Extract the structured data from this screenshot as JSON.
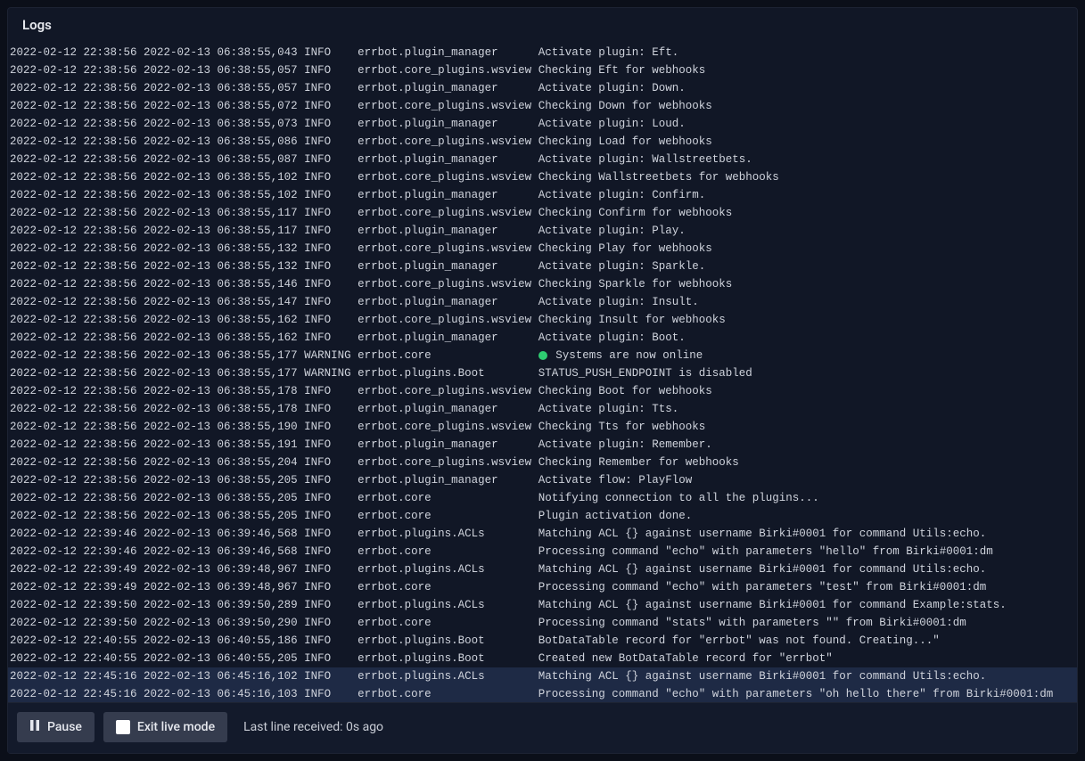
{
  "header": {
    "title": "Logs"
  },
  "columns": {
    "ts1_width": 9,
    "ts2_width": 24,
    "level_width": 8,
    "logger_width": 26
  },
  "footer": {
    "pause_label": "Pause",
    "exit_label": "Exit live mode",
    "last_line_label": "Last line received: 0s ago"
  },
  "logs": [
    {
      "ts1": "2022-02-12 22:38:56",
      "ts2": "2022-02-13 06:38:55,043",
      "level": "INFO",
      "logger": "errbot.plugin_manager",
      "msg": "Activate plugin: Eft."
    },
    {
      "ts1": "2022-02-12 22:38:56",
      "ts2": "2022-02-13 06:38:55,057",
      "level": "INFO",
      "logger": "errbot.core_plugins.wsview",
      "msg": "Checking Eft for webhooks"
    },
    {
      "ts1": "2022-02-12 22:38:56",
      "ts2": "2022-02-13 06:38:55,057",
      "level": "INFO",
      "logger": "errbot.plugin_manager",
      "msg": "Activate plugin: Down."
    },
    {
      "ts1": "2022-02-12 22:38:56",
      "ts2": "2022-02-13 06:38:55,072",
      "level": "INFO",
      "logger": "errbot.core_plugins.wsview",
      "msg": "Checking Down for webhooks"
    },
    {
      "ts1": "2022-02-12 22:38:56",
      "ts2": "2022-02-13 06:38:55,073",
      "level": "INFO",
      "logger": "errbot.plugin_manager",
      "msg": "Activate plugin: Loud."
    },
    {
      "ts1": "2022-02-12 22:38:56",
      "ts2": "2022-02-13 06:38:55,086",
      "level": "INFO",
      "logger": "errbot.core_plugins.wsview",
      "msg": "Checking Load for webhooks"
    },
    {
      "ts1": "2022-02-12 22:38:56",
      "ts2": "2022-02-13 06:38:55,087",
      "level": "INFO",
      "logger": "errbot.plugin_manager",
      "msg": "Activate plugin: Wallstreetbets."
    },
    {
      "ts1": "2022-02-12 22:38:56",
      "ts2": "2022-02-13 06:38:55,102",
      "level": "INFO",
      "logger": "errbot.core_plugins.wsview",
      "msg": "Checking Wallstreetbets for webhooks"
    },
    {
      "ts1": "2022-02-12 22:38:56",
      "ts2": "2022-02-13 06:38:55,102",
      "level": "INFO",
      "logger": "errbot.plugin_manager",
      "msg": "Activate plugin: Confirm."
    },
    {
      "ts1": "2022-02-12 22:38:56",
      "ts2": "2022-02-13 06:38:55,117",
      "level": "INFO",
      "logger": "errbot.core_plugins.wsview",
      "msg": "Checking Confirm for webhooks"
    },
    {
      "ts1": "2022-02-12 22:38:56",
      "ts2": "2022-02-13 06:38:55,117",
      "level": "INFO",
      "logger": "errbot.plugin_manager",
      "msg": "Activate plugin: Play."
    },
    {
      "ts1": "2022-02-12 22:38:56",
      "ts2": "2022-02-13 06:38:55,132",
      "level": "INFO",
      "logger": "errbot.core_plugins.wsview",
      "msg": "Checking Play for webhooks"
    },
    {
      "ts1": "2022-02-12 22:38:56",
      "ts2": "2022-02-13 06:38:55,132",
      "level": "INFO",
      "logger": "errbot.plugin_manager",
      "msg": "Activate plugin: Sparkle."
    },
    {
      "ts1": "2022-02-12 22:38:56",
      "ts2": "2022-02-13 06:38:55,146",
      "level": "INFO",
      "logger": "errbot.core_plugins.wsview",
      "msg": "Checking Sparkle for webhooks"
    },
    {
      "ts1": "2022-02-12 22:38:56",
      "ts2": "2022-02-13 06:38:55,147",
      "level": "INFO",
      "logger": "errbot.plugin_manager",
      "msg": "Activate plugin: Insult."
    },
    {
      "ts1": "2022-02-12 22:38:56",
      "ts2": "2022-02-13 06:38:55,162",
      "level": "INFO",
      "logger": "errbot.core_plugins.wsview",
      "msg": "Checking Insult for webhooks"
    },
    {
      "ts1": "2022-02-12 22:38:56",
      "ts2": "2022-02-13 06:38:55,162",
      "level": "INFO",
      "logger": "errbot.plugin_manager",
      "msg": "Activate plugin: Boot."
    },
    {
      "ts1": "2022-02-12 22:38:56",
      "ts2": "2022-02-13 06:38:55,177",
      "level": "WARNING",
      "logger": "errbot.core",
      "msg": "Systems are now online",
      "dot": true
    },
    {
      "ts1": "2022-02-12 22:38:56",
      "ts2": "2022-02-13 06:38:55,177",
      "level": "WARNING",
      "logger": "errbot.plugins.Boot",
      "msg": "STATUS_PUSH_ENDPOINT is disabled"
    },
    {
      "ts1": "2022-02-12 22:38:56",
      "ts2": "2022-02-13 06:38:55,178",
      "level": "INFO",
      "logger": "errbot.core_plugins.wsview",
      "msg": "Checking Boot for webhooks"
    },
    {
      "ts1": "2022-02-12 22:38:56",
      "ts2": "2022-02-13 06:38:55,178",
      "level": "INFO",
      "logger": "errbot.plugin_manager",
      "msg": "Activate plugin: Tts."
    },
    {
      "ts1": "2022-02-12 22:38:56",
      "ts2": "2022-02-13 06:38:55,190",
      "level": "INFO",
      "logger": "errbot.core_plugins.wsview",
      "msg": "Checking Tts for webhooks"
    },
    {
      "ts1": "2022-02-12 22:38:56",
      "ts2": "2022-02-13 06:38:55,191",
      "level": "INFO",
      "logger": "errbot.plugin_manager",
      "msg": "Activate plugin: Remember."
    },
    {
      "ts1": "2022-02-12 22:38:56",
      "ts2": "2022-02-13 06:38:55,204",
      "level": "INFO",
      "logger": "errbot.core_plugins.wsview",
      "msg": "Checking Remember for webhooks"
    },
    {
      "ts1": "2022-02-12 22:38:56",
      "ts2": "2022-02-13 06:38:55,205",
      "level": "INFO",
      "logger": "errbot.plugin_manager",
      "msg": "Activate flow: PlayFlow"
    },
    {
      "ts1": "2022-02-12 22:38:56",
      "ts2": "2022-02-13 06:38:55,205",
      "level": "INFO",
      "logger": "errbot.core",
      "msg": "Notifying connection to all the plugins..."
    },
    {
      "ts1": "2022-02-12 22:38:56",
      "ts2": "2022-02-13 06:38:55,205",
      "level": "INFO",
      "logger": "errbot.core",
      "msg": "Plugin activation done."
    },
    {
      "ts1": "2022-02-12 22:39:46",
      "ts2": "2022-02-13 06:39:46,568",
      "level": "INFO",
      "logger": "errbot.plugins.ACLs",
      "msg": "Matching ACL {} against username Birki#0001 for command Utils:echo."
    },
    {
      "ts1": "2022-02-12 22:39:46",
      "ts2": "2022-02-13 06:39:46,568",
      "level": "INFO",
      "logger": "errbot.core",
      "msg": "Processing command \"echo\" with parameters \"hello\" from Birki#0001:dm"
    },
    {
      "ts1": "2022-02-12 22:39:49",
      "ts2": "2022-02-13 06:39:48,967",
      "level": "INFO",
      "logger": "errbot.plugins.ACLs",
      "msg": "Matching ACL {} against username Birki#0001 for command Utils:echo."
    },
    {
      "ts1": "2022-02-12 22:39:49",
      "ts2": "2022-02-13 06:39:48,967",
      "level": "INFO",
      "logger": "errbot.core",
      "msg": "Processing command \"echo\" with parameters \"test\" from Birki#0001:dm"
    },
    {
      "ts1": "2022-02-12 22:39:50",
      "ts2": "2022-02-13 06:39:50,289",
      "level": "INFO",
      "logger": "errbot.plugins.ACLs",
      "msg": "Matching ACL {} against username Birki#0001 for command Example:stats."
    },
    {
      "ts1": "2022-02-12 22:39:50",
      "ts2": "2022-02-13 06:39:50,290",
      "level": "INFO",
      "logger": "errbot.core",
      "msg": "Processing command \"stats\" with parameters \"\" from Birki#0001:dm"
    },
    {
      "ts1": "2022-02-12 22:40:55",
      "ts2": "2022-02-13 06:40:55,186",
      "level": "INFO",
      "logger": "errbot.plugins.Boot",
      "msg": "BotDataTable record for \"errbot\" was not found. Creating...\""
    },
    {
      "ts1": "2022-02-12 22:40:55",
      "ts2": "2022-02-13 06:40:55,205",
      "level": "INFO",
      "logger": "errbot.plugins.Boot",
      "msg": "Created new BotDataTable record for \"errbot\""
    },
    {
      "ts1": "2022-02-12 22:45:16",
      "ts2": "2022-02-13 06:45:16,102",
      "level": "INFO",
      "logger": "errbot.plugins.ACLs",
      "msg": "Matching ACL {} against username Birki#0001 for command Utils:echo.",
      "hl": true
    },
    {
      "ts1": "2022-02-12 22:45:16",
      "ts2": "2022-02-13 06:45:16,103",
      "level": "INFO",
      "logger": "errbot.core",
      "msg": "Processing command \"echo\" with parameters \"oh hello there\" from Birki#0001:dm",
      "hl": true
    }
  ]
}
